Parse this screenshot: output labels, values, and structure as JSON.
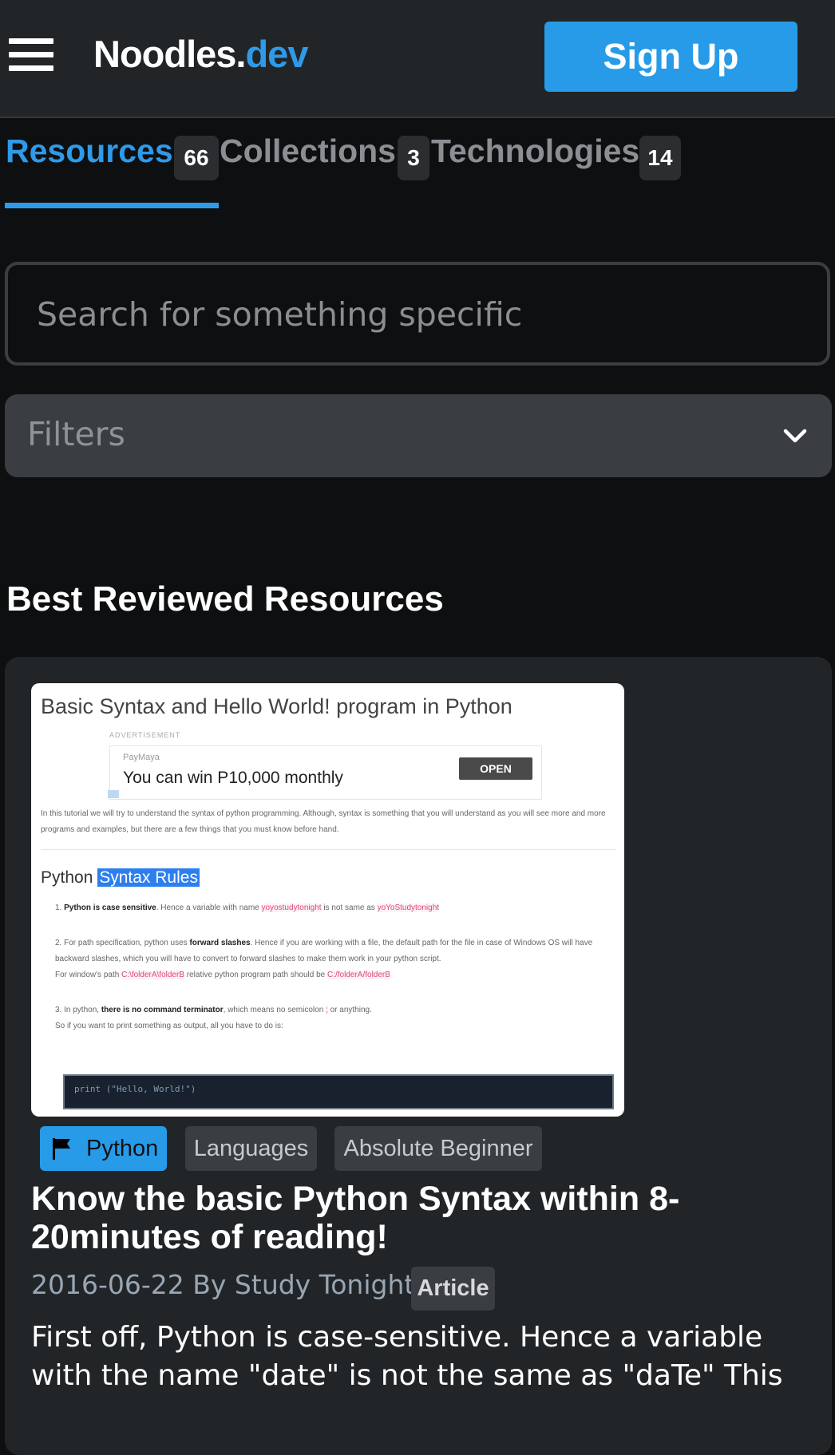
{
  "header": {
    "logo_main": "Noodles.",
    "logo_accent": "dev",
    "signup_label": "Sign Up"
  },
  "tabs": [
    {
      "label": "Resources",
      "count": "66",
      "active": true
    },
    {
      "label": "Collections",
      "count": "3",
      "active": false
    },
    {
      "label": "Technologies",
      "count": "14",
      "active": false
    }
  ],
  "search": {
    "placeholder": "Search for something specific",
    "value": ""
  },
  "filters": {
    "label": "Filters"
  },
  "section": {
    "title": "Best Reviewed Resources"
  },
  "resource": {
    "thumbnail": {
      "title": "Basic Syntax and Hello World! program in Python",
      "ad_label": "ADVERTISEMENT",
      "ad_brand": "PayMaya",
      "ad_headline": "You can win P10,000 monthly",
      "ad_button": "OPEN",
      "intro": "In this tutorial we will try to understand the syntax of python programming. Although, syntax is something that you will understand as you will see more and more programs and examples, but there are a few things that you must know before hand.",
      "heading_plain": "Python ",
      "heading_highlight": "Syntax Rules",
      "rule1_bold": "Python is case sensitive",
      "rule1_text": ". Hence a variable with name ",
      "rule1_code1": "yoyostudytonight",
      "rule1_mid": " is not same as ",
      "rule1_code2": "yoYoStudytonight",
      "rule2_pre": "For path specification, python uses ",
      "rule2_bold": "forward slashes",
      "rule2_text": ". Hence if you are working with a file, the default path for the file in case of Windows OS will have backward slashes, which you will have to convert to forward slashes to make them work in your python script.",
      "rule2_line2_pre": "For window's path ",
      "rule2_code1": "C:\\folderA\\folderB",
      "rule2_line2_mid": " relative python program path should be ",
      "rule2_code2": "C:/folderA/folderB",
      "rule3_pre": "In python, ",
      "rule3_bold": "there is no command terminator",
      "rule3_text": ", which means no semicolon ",
      "rule3_code": ";",
      "rule3_end": " or anything.",
      "rule3_line2": "So if you want to print something as output, all you have to do is:",
      "code_sample": "print (\"Hello, World!\")"
    },
    "tags": [
      {
        "label": "Python",
        "icon": "flag-icon",
        "primary": true
      },
      {
        "label": "Languages",
        "primary": false
      },
      {
        "label": "Absolute Beginner",
        "primary": false
      }
    ],
    "title": "Know the basic Python Syntax within 8-20minutes of reading!",
    "meta": "2016-06-22 By Study Tonight",
    "type": "Article",
    "description": "First off, Python is case-sensitive. Hence a variable with the name \"date\" is not the same as \"daTe\" This"
  },
  "colors": {
    "accent": "#2f9ae9",
    "background": "#0e0f10",
    "header": "#222527",
    "card": "#222527"
  }
}
